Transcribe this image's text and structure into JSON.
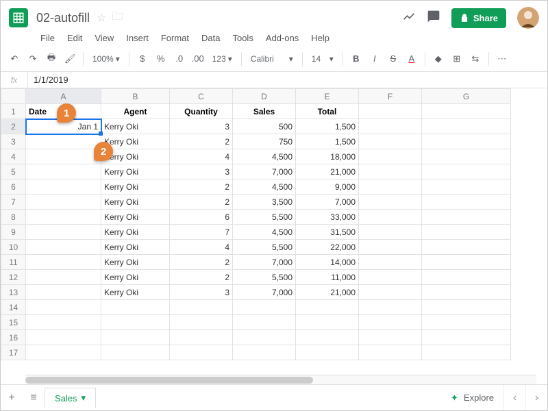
{
  "doc": {
    "name": "02-autofill"
  },
  "menus": [
    "File",
    "Edit",
    "View",
    "Insert",
    "Format",
    "Data",
    "Tools",
    "Add-ons",
    "Help"
  ],
  "share": "Share",
  "toolbar": {
    "zoom": "100%",
    "font": "Calibri",
    "size": "14",
    "numfmt": "123"
  },
  "formula_bar": "1/1/2019",
  "columns": [
    "A",
    "B",
    "C",
    "D",
    "E",
    "F",
    "G"
  ],
  "headers": {
    "date": "Date",
    "agent": "Agent",
    "qty": "Quantity",
    "sales": "Sales",
    "total": "Total"
  },
  "selected_value": "Jan 1",
  "rows": [
    {
      "agent": "Kerry Oki",
      "qty": "3",
      "sales": "500",
      "total": "1,500"
    },
    {
      "agent": "Kerry Oki",
      "qty": "2",
      "sales": "750",
      "total": "1,500"
    },
    {
      "agent": "Kerry Oki",
      "qty": "4",
      "sales": "4,500",
      "total": "18,000"
    },
    {
      "agent": "Kerry Oki",
      "qty": "3",
      "sales": "7,000",
      "total": "21,000"
    },
    {
      "agent": "Kerry Oki",
      "qty": "2",
      "sales": "4,500",
      "total": "9,000"
    },
    {
      "agent": "Kerry Oki",
      "qty": "2",
      "sales": "3,500",
      "total": "7,000"
    },
    {
      "agent": "Kerry Oki",
      "qty": "6",
      "sales": "5,500",
      "total": "33,000"
    },
    {
      "agent": "Kerry Oki",
      "qty": "7",
      "sales": "4,500",
      "total": "31,500"
    },
    {
      "agent": "Kerry Oki",
      "qty": "4",
      "sales": "5,500",
      "total": "22,000"
    },
    {
      "agent": "Kerry Oki",
      "qty": "2",
      "sales": "7,000",
      "total": "14,000"
    },
    {
      "agent": "Kerry Oki",
      "qty": "2",
      "sales": "5,500",
      "total": "11,000"
    },
    {
      "agent": "Kerry Oki",
      "qty": "3",
      "sales": "7,000",
      "total": "21,000"
    }
  ],
  "tab": "Sales",
  "explore": "Explore",
  "callouts": {
    "c1": "1",
    "c2": "2"
  }
}
